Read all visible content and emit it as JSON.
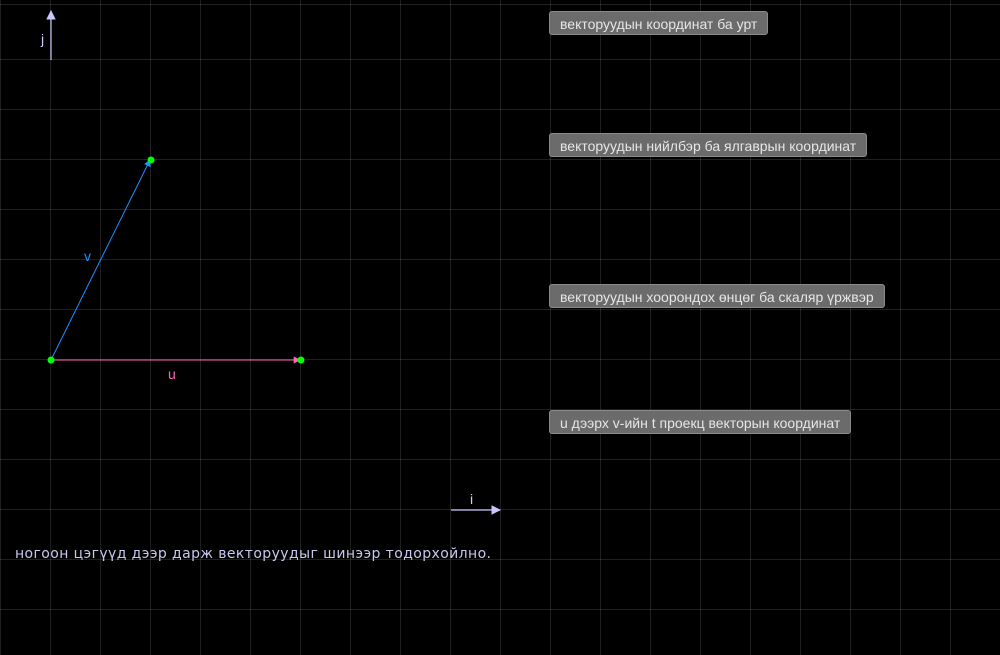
{
  "canvas": {
    "axis_i_label": "i",
    "axis_j_label": "j",
    "vector_u": {
      "label": "u",
      "color": "#ff69b4",
      "tip_color": "#00ff00"
    },
    "vector_v": {
      "label": "v",
      "color": "#1e90ff",
      "tip_color": "#00ff00"
    },
    "hint": "ногоон цэгүүд дээр дарж векторуудыг шинээр тодорхойлно."
  },
  "buttons": {
    "coord_length": "векторуудын координат ба урт",
    "sum_diff": "векторуудын нийлбэр ба ялгаврын координат",
    "angle_scalar": "векторуудын хоорондох өнцөг ба скаляр үржвэр",
    "projection": "u дээрх v-ийн t проекц векторын координат"
  },
  "colors": {
    "background": "#000000",
    "axis": "#c8c8ff",
    "button_bg": "#6b6b6b",
    "button_text": "#e6e6e6"
  }
}
